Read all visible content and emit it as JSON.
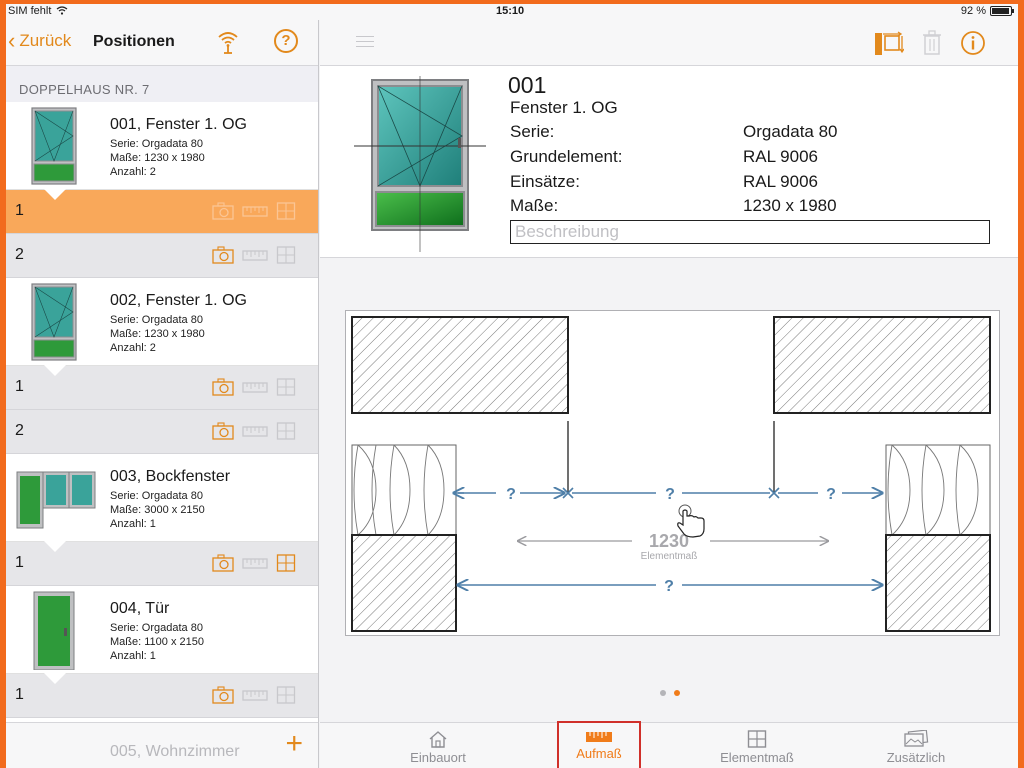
{
  "status_bar": {
    "carrier": "SIM fehlt",
    "time": "15:10",
    "battery": "92 %",
    "battery_fraction": 0.92
  },
  "left_nav": {
    "back_label": "Zurück",
    "title": "Positionen"
  },
  "section_title": "DOPPELHAUS NR. 7",
  "items": [
    {
      "title": "001, Fenster 1. OG",
      "serie": "Serie: Orgadata 80",
      "masse": "Maße: 1230 x 1980",
      "anzahl": "Anzahl: 2",
      "subs": [
        {
          "num": "1",
          "active": true
        },
        {
          "num": "2",
          "active": false
        }
      ]
    },
    {
      "title": "002, Fenster 1. OG",
      "serie": "Serie: Orgadata 80",
      "masse": "Maße: 1230 x 1980",
      "anzahl": "Anzahl: 2",
      "subs": [
        {
          "num": "1",
          "active": false
        },
        {
          "num": "2",
          "active": false
        }
      ]
    },
    {
      "title": "003, Bockfenster",
      "serie": "Serie: Orgadata 80",
      "masse": "Maße: 3000 x 2150",
      "anzahl": "Anzahl: 1",
      "subs": [
        {
          "num": "1",
          "active": false
        }
      ]
    },
    {
      "title": "004, Tür",
      "serie": "Serie: Orgadata 80",
      "masse": "Maße: 1100 x 2150",
      "anzahl": "Anzahl: 1",
      "subs": [
        {
          "num": "1",
          "active": false
        }
      ]
    }
  ],
  "peek_item": "005, Wohnzimmer",
  "detail": {
    "id": "001",
    "name": "Fenster 1. OG",
    "rows": [
      {
        "label": "Serie:",
        "value": "Orgadata 80"
      },
      {
        "label": "Grundelement:",
        "value": "RAL 9006"
      },
      {
        "label": "Einsätze:",
        "value": "RAL 9006"
      },
      {
        "label": "Maße:",
        "value": "1230 x 1980"
      }
    ],
    "description_placeholder": "Beschreibung"
  },
  "drawing": {
    "unknown_mark": "?",
    "element_width": "1230",
    "element_label": "Elementmaß"
  },
  "page_dots": {
    "count": 2,
    "active": 1
  },
  "tabs": [
    {
      "label": "Einbauort",
      "icon": "house-icon"
    },
    {
      "label": "Aufmaß",
      "icon": "ruler-icon"
    },
    {
      "label": "Elementmaß",
      "icon": "grid-icon"
    },
    {
      "label": "Zusätzlich",
      "icon": "photos-icon"
    }
  ],
  "colors": {
    "accent": "#e2891c",
    "active_row": "#f9a85a",
    "dimension_blue": "#4f7fa8",
    "glass": "#3aa39a",
    "panel_green": "#2e9a3a",
    "frame": "#9a9a9e",
    "device_border": "#f26b1d"
  }
}
